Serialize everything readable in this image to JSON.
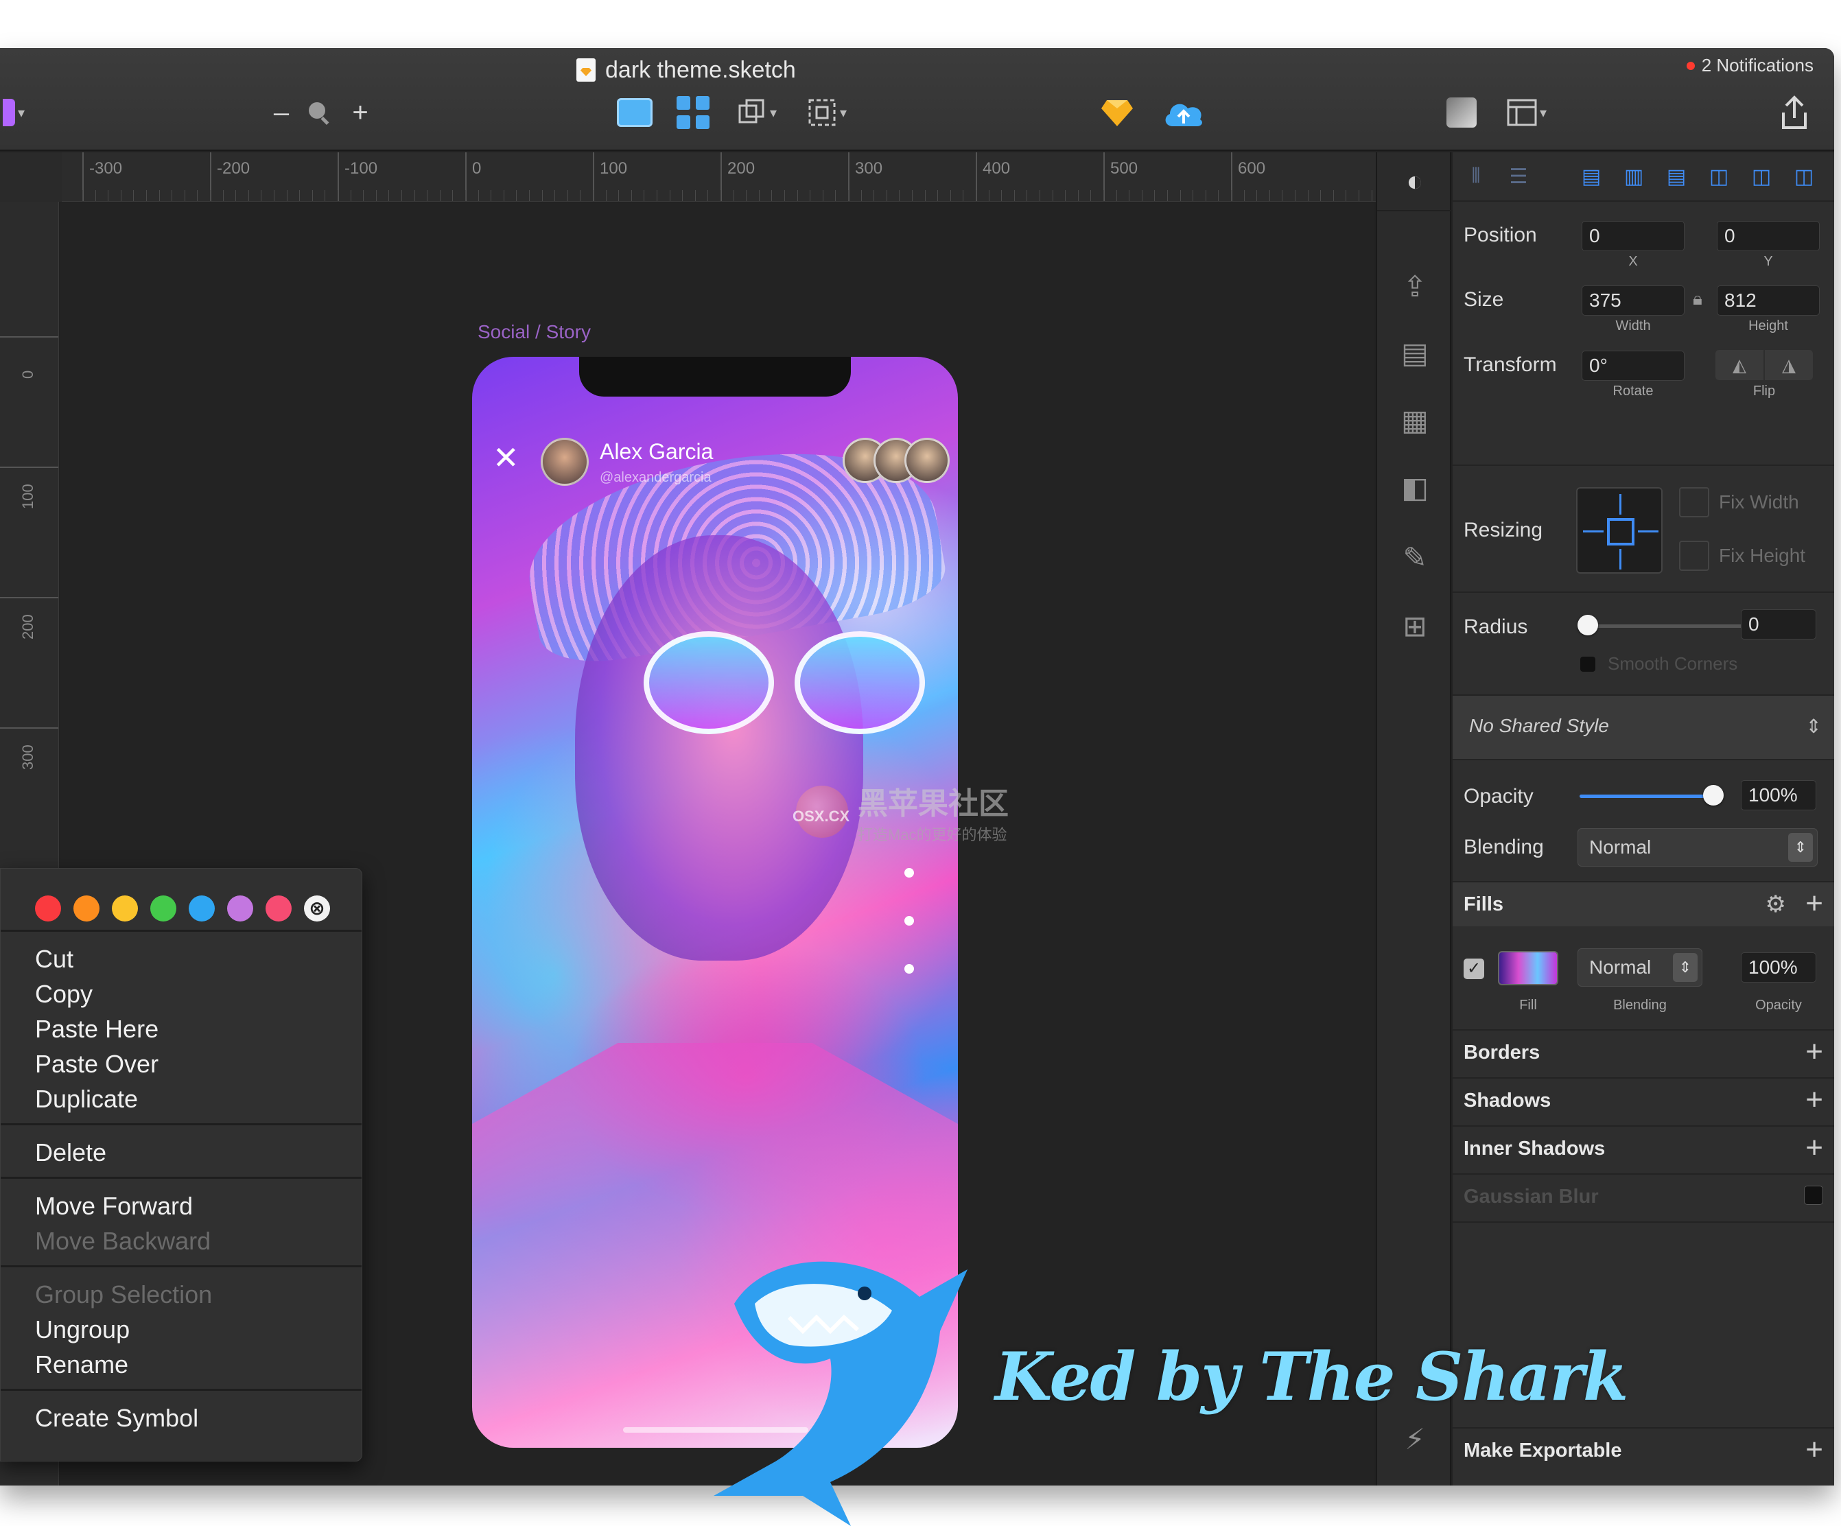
{
  "window": {
    "doc_title": "dark theme.sketch",
    "notifications": "2 Notifications"
  },
  "toolbar": {
    "zoom_minus": "–",
    "zoom_plus": "+"
  },
  "ruler": {
    "h_ticks": [
      "-300",
      "-200",
      "-100",
      "0",
      "100",
      "200",
      "300",
      "400",
      "500",
      "600"
    ],
    "v_ticks": [
      "0",
      "100",
      "200",
      "300"
    ]
  },
  "canvas": {
    "artboard_label": "Social / Story",
    "story": {
      "user_name": "Alex Garcia",
      "user_handle": "@alexandergarcia",
      "close": "✕"
    }
  },
  "watermark": {
    "main": "黑苹果社区",
    "sub": "打造Mac的更好的体验",
    "osx": "OSX.CX"
  },
  "context_menu": {
    "colors": [
      "#fa3a3f",
      "#fd8d1e",
      "#fbc42c",
      "#44c94b",
      "#2fa6f2",
      "#c377e0",
      "#f64c72"
    ],
    "clear_icon": "⊗",
    "groups": [
      [
        {
          "label": "Cut",
          "enabled": true
        },
        {
          "label": "Copy",
          "enabled": true
        },
        {
          "label": "Paste Here",
          "enabled": true
        },
        {
          "label": "Paste Over",
          "enabled": true
        },
        {
          "label": "Duplicate",
          "enabled": true
        }
      ],
      [
        {
          "label": "Delete",
          "enabled": true
        }
      ],
      [
        {
          "label": "Move Forward",
          "enabled": true
        },
        {
          "label": "Move Backward",
          "enabled": false
        }
      ],
      [
        {
          "label": "Group Selection",
          "enabled": false
        },
        {
          "label": "Ungroup",
          "enabled": true
        },
        {
          "label": "Rename",
          "enabled": true
        }
      ],
      [
        {
          "label": "Create Symbol",
          "enabled": true
        }
      ]
    ]
  },
  "inspector": {
    "position": {
      "label": "Position",
      "x": "0",
      "y": "0",
      "x_label": "X",
      "y_label": "Y"
    },
    "size": {
      "label": "Size",
      "width": "375",
      "height": "812",
      "width_label": "Width",
      "height_label": "Height"
    },
    "transform": {
      "label": "Transform",
      "rotate": "0°",
      "rotate_label": "Rotate",
      "flip_label": "Flip"
    },
    "resizing": {
      "label": "Resizing",
      "fix_width": "Fix Width",
      "fix_height": "Fix Height"
    },
    "radius": {
      "label": "Radius",
      "value": "0",
      "smooth_corners": "Smooth Corners"
    },
    "shared_style": "No Shared Style",
    "opacity": {
      "label": "Opacity",
      "value": "100%",
      "level": 1.0
    },
    "blending": {
      "label": "Blending",
      "value": "Normal"
    },
    "fills": {
      "title": "Fills",
      "blend": "Normal",
      "opacity": "100%",
      "fill_label": "Fill",
      "blending_label": "Blending",
      "opacity_label": "Opacity"
    },
    "borders": "Borders",
    "shadows": "Shadows",
    "inner_shadows": "Inner Shadows",
    "gaussian_blur": "Gaussian Blur",
    "make_exportable": "Make Exportable"
  },
  "overlay": {
    "signature": "Ked by The Shark"
  },
  "colors": {
    "accent": "#3f8cf5",
    "artboard_label": "#9a63c6"
  }
}
